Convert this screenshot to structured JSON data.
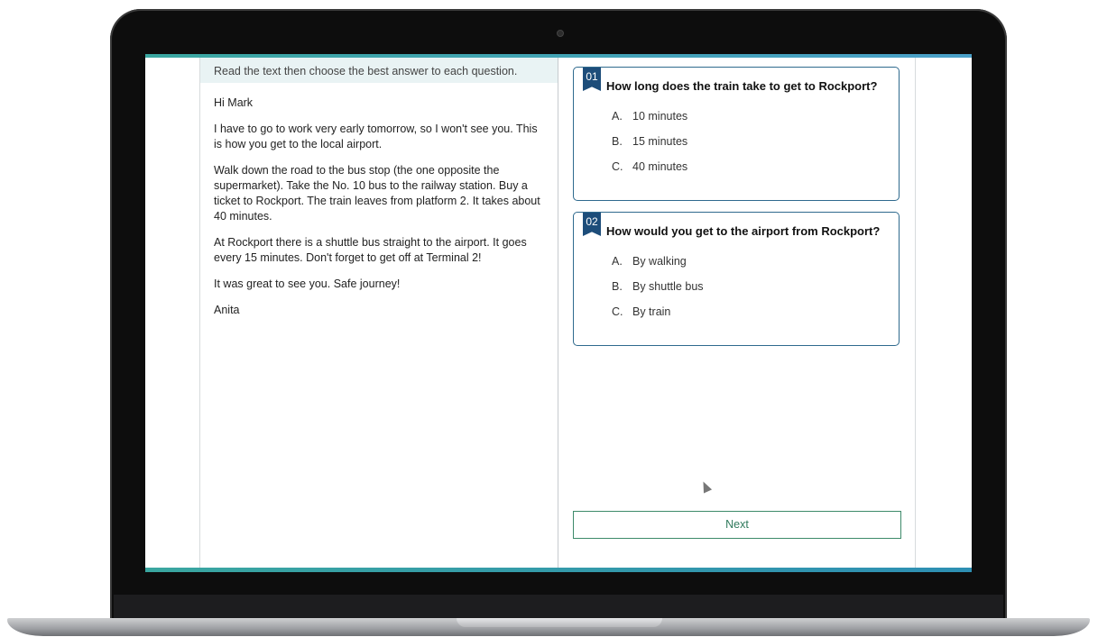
{
  "instruction": "Read the text then choose the best answer to each question.",
  "passage": {
    "greeting": "Hi Mark",
    "paragraphs": [
      "I have to go to work very early tomorrow, so I won't see you. This is how you get to the local airport.",
      "Walk down the road to the bus stop (the one opposite the supermarket). Take the No. 10 bus to the railway station. Buy a ticket to Rockport. The train leaves from platform 2. It takes about 40 minutes.",
      "At Rockport there is a shuttle bus straight to the airport. It goes every 15 minutes. Don't forget to get off at Terminal 2!",
      "It was great to see you. Safe journey!"
    ],
    "signature": "Anita"
  },
  "questions": [
    {
      "number": "01",
      "text": "How long does the train take to get to Rockport?",
      "options": [
        {
          "letter": "A.",
          "text": "10 minutes"
        },
        {
          "letter": "B.",
          "text": "15 minutes"
        },
        {
          "letter": "C.",
          "text": "40 minutes"
        }
      ]
    },
    {
      "number": "02",
      "text": "How would you get to the airport from Rockport?",
      "options": [
        {
          "letter": "A.",
          "text": "By walking"
        },
        {
          "letter": "B.",
          "text": "By shuttle bus"
        },
        {
          "letter": "C.",
          "text": "By train"
        }
      ]
    }
  ],
  "next_label": "Next",
  "colors": {
    "accent_teal": "#3aa6a0",
    "question_border": "#2f6a8e",
    "question_badge": "#1d4d7a",
    "next_text": "#2f7a5c",
    "instruction_bg": "#e9f3f4"
  }
}
